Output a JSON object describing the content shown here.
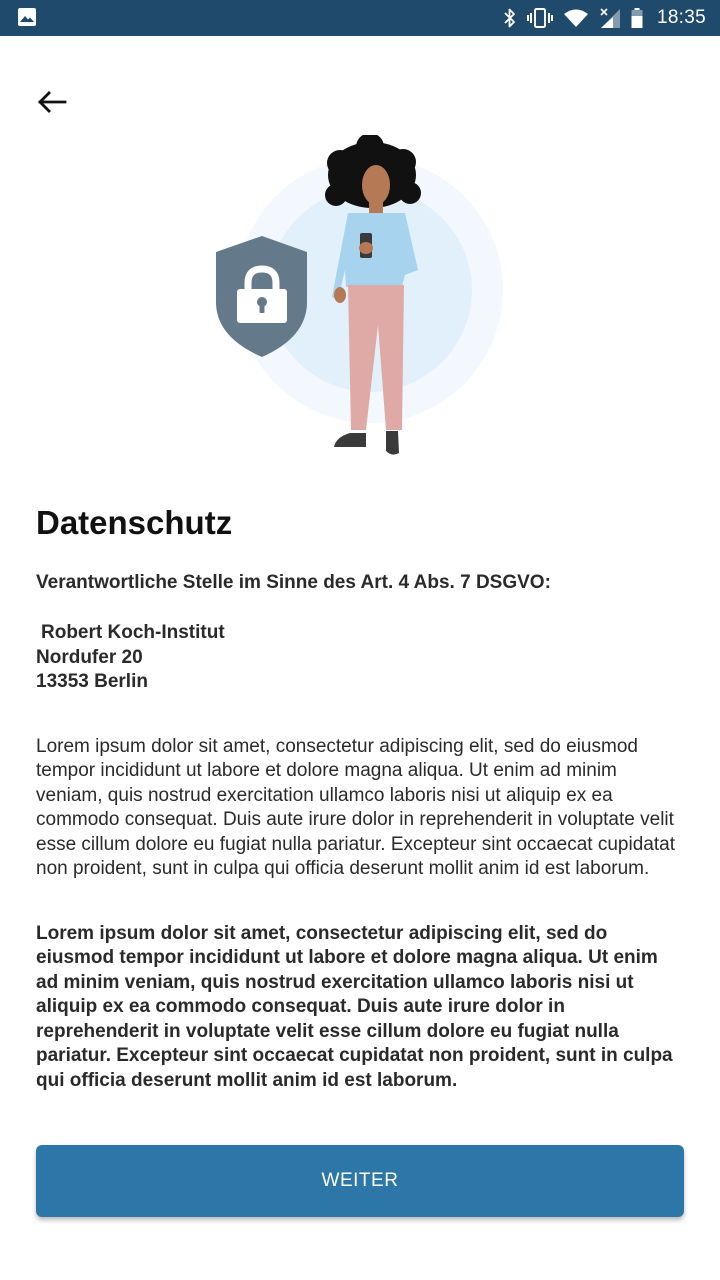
{
  "status_bar": {
    "time": "18:35",
    "icons": [
      "image-icon",
      "bluetooth-icon",
      "vibrate-icon",
      "wifi-icon",
      "signal-icon",
      "battery-icon"
    ]
  },
  "header": {
    "back_icon": "arrow-left-icon"
  },
  "illustration": {
    "description_icons": [
      "shield-lock-icon",
      "person-with-phone-illustration"
    ]
  },
  "content": {
    "title": "Datenschutz",
    "subtitle": "Verantwortliche Stelle im Sinne des Art. 4 Abs. 7 DSGVO:",
    "address": {
      "line1": "Robert Koch-Institut",
      "line2": "Nordufer 20",
      "line3": "13353 Berlin"
    },
    "paragraph_regular": "Lorem ipsum dolor sit amet, consectetur adipiscing elit, sed do eiusmod tempor incididunt ut labore et dolore magna aliqua. Ut enim ad minim veniam, quis nostrud exercitation ullamco laboris nisi ut aliquip ex ea commodo consequat. Duis aute irure dolor in reprehenderit in voluptate velit esse cillum dolore eu fugiat nulla pariatur. Excepteur sint occaecat cupidatat non proident, sunt in culpa qui officia deserunt mollit anim id est laborum.",
    "paragraph_bold": "Lorem ipsum dolor sit amet, consectetur adipiscing elit, sed do eiusmod tempor incididunt ut labore et dolore magna aliqua. Ut enim ad minim veniam, quis nostrud exercitation ullamco laboris nisi ut aliquip ex ea commodo consequat. Duis aute irure dolor in reprehenderit in voluptate velit esse cillum dolore eu fugiat nulla pariatur. Excepteur sint occaecat cupidatat non proident, sunt in culpa qui officia deserunt mollit anim id est laborum."
  },
  "footer": {
    "button_label": "WEITER"
  },
  "colors": {
    "status_bar": "#1f4a6b",
    "primary": "#2c77a8",
    "shield": "#64798a",
    "text": "#2a2a2a"
  }
}
